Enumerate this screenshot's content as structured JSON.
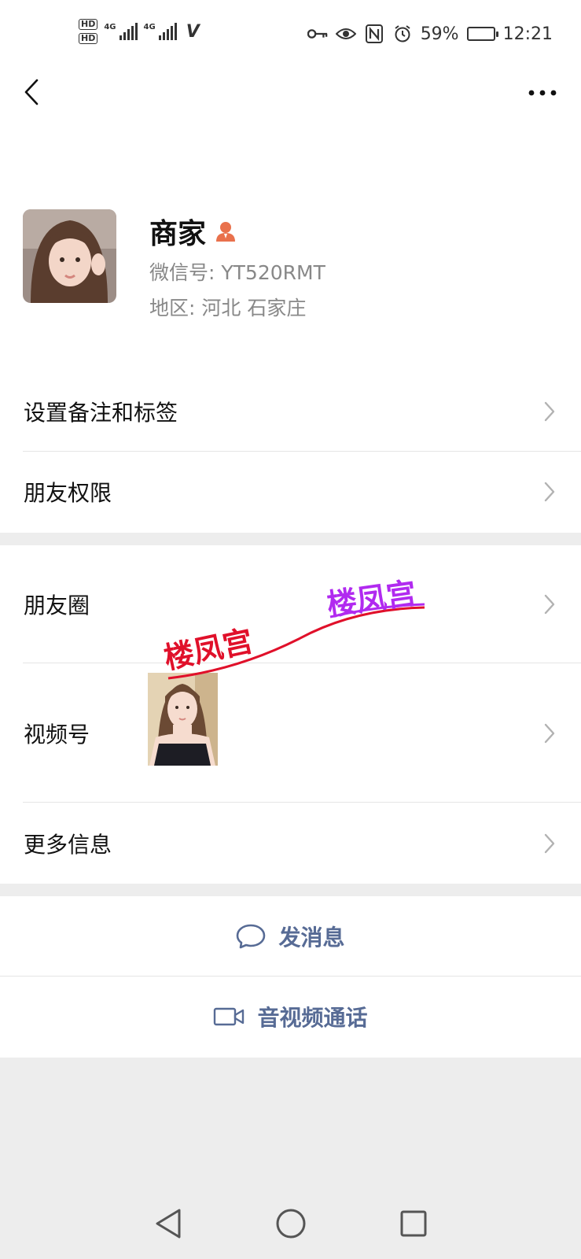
{
  "status_bar": {
    "hd1": "HD",
    "hd2": "HD",
    "net1": "4G",
    "net2": "4G",
    "battery_percent": "59%",
    "battery_level": 0.59,
    "time": "12:21",
    "icons": [
      "key-icon",
      "eye-icon",
      "nfc-icon",
      "alarm-icon"
    ]
  },
  "profile": {
    "name": "商家",
    "wechat_id": "微信号:  YT520RMT",
    "region": "地区:  河北  石家庄"
  },
  "menu": {
    "remarks_tags": "设置备注和标签",
    "friend_permissions": "朋友权限",
    "moments": "朋友圈",
    "channels": "视频号",
    "more_info": "更多信息"
  },
  "actions": {
    "send_message": "发消息",
    "av_call": "音视频通话"
  },
  "watermark": {
    "text1": "楼凤宫",
    "text2": "楼凤宫"
  },
  "colors": {
    "link": "#576b95",
    "badge": "#e9714c",
    "watermark_red": "#e0102a",
    "watermark_purple": "#b12af0"
  }
}
